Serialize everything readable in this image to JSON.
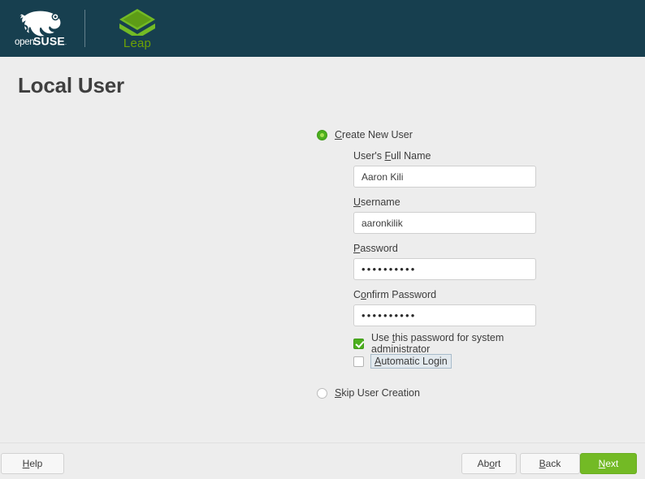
{
  "window": {
    "title": "Local User",
    "banner_bg": "#173f4f",
    "accent_green": "#73ba25"
  },
  "header": {
    "distro_name_light": "open",
    "distro_name_bold": "SUSE",
    "product_name": "Leap"
  },
  "main": {
    "options": {
      "create_new_user": {
        "label_pre": "",
        "mnemonic": "C",
        "label_post": "reate New User",
        "selected": true
      },
      "skip_user_creation": {
        "label_pre": "",
        "mnemonic": "S",
        "label_post": "kip User Creation",
        "selected": false
      }
    },
    "fields": [
      {
        "label_pre": "User's ",
        "mnemonic": "F",
        "label_post": "ull Name",
        "value": "Aaron Kili",
        "type": "text"
      },
      {
        "label_pre": "",
        "mnemonic": "U",
        "label_post": "sername",
        "value": "aaronkilik",
        "type": "text"
      },
      {
        "label_pre": "",
        "mnemonic": "P",
        "label_post": "assword",
        "value": "••••••••••",
        "type": "password"
      },
      {
        "label_pre": "C",
        "mnemonic": "o",
        "label_post": "nfirm Password",
        "value": "••••••••••",
        "type": "password"
      }
    ],
    "checkboxes": [
      {
        "label_pre": "Use ",
        "mnemonic": "t",
        "label_post": "his password for system administrator",
        "checked": true,
        "focused": false
      },
      {
        "label_pre": "",
        "mnemonic": "A",
        "label_post": "utomatic Login",
        "checked": false,
        "focused": true
      }
    ]
  },
  "footer": {
    "help": {
      "label_pre": "",
      "mnemonic": "H",
      "label_post": "elp"
    },
    "abort": {
      "label_pre": "Ab",
      "mnemonic": "o",
      "label_post": "rt"
    },
    "back": {
      "label_pre": "",
      "mnemonic": "B",
      "label_post": "ack"
    },
    "next": {
      "label_pre": "",
      "mnemonic": "N",
      "label_post": "ext"
    }
  }
}
